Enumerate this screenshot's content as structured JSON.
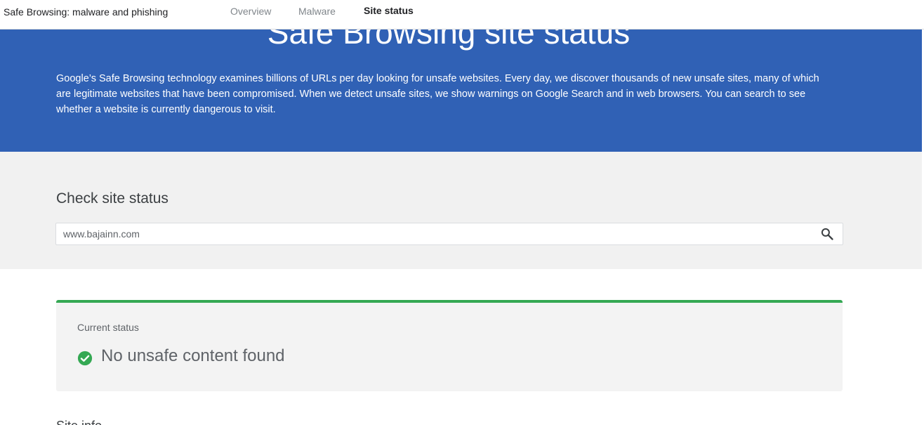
{
  "header": {
    "site_title": "Safe Browsing: malware and phishing",
    "tabs": [
      {
        "label": "Overview"
      },
      {
        "label": "Malware"
      },
      {
        "label": "Site status"
      }
    ],
    "active_tab": "Site status"
  },
  "hero": {
    "title": "Safe Browsing site status",
    "description": "Google’s Safe Browsing technology examines billions of URLs per day looking for unsafe websites. Every day, we discover thousands of new unsafe sites, many of which are legitimate websites that have been compromised. When we detect unsafe sites, we show warnings on Google Search and in web browsers. You can search to see whether a website is currently dangerous to visit."
  },
  "check": {
    "heading": "Check site status",
    "search_value": "www.bajainn.com",
    "search_icon": "search-icon"
  },
  "status": {
    "label": "Current status",
    "result": "No unsafe content found",
    "icon": "check-circle-icon",
    "accent_color": "#34a853"
  },
  "site_info": {
    "heading": "Site info"
  },
  "colors": {
    "hero_bg": "#3061b5",
    "band_bg": "#f1f1f1",
    "card_bg": "#f3f3f3",
    "success": "#34a853"
  }
}
